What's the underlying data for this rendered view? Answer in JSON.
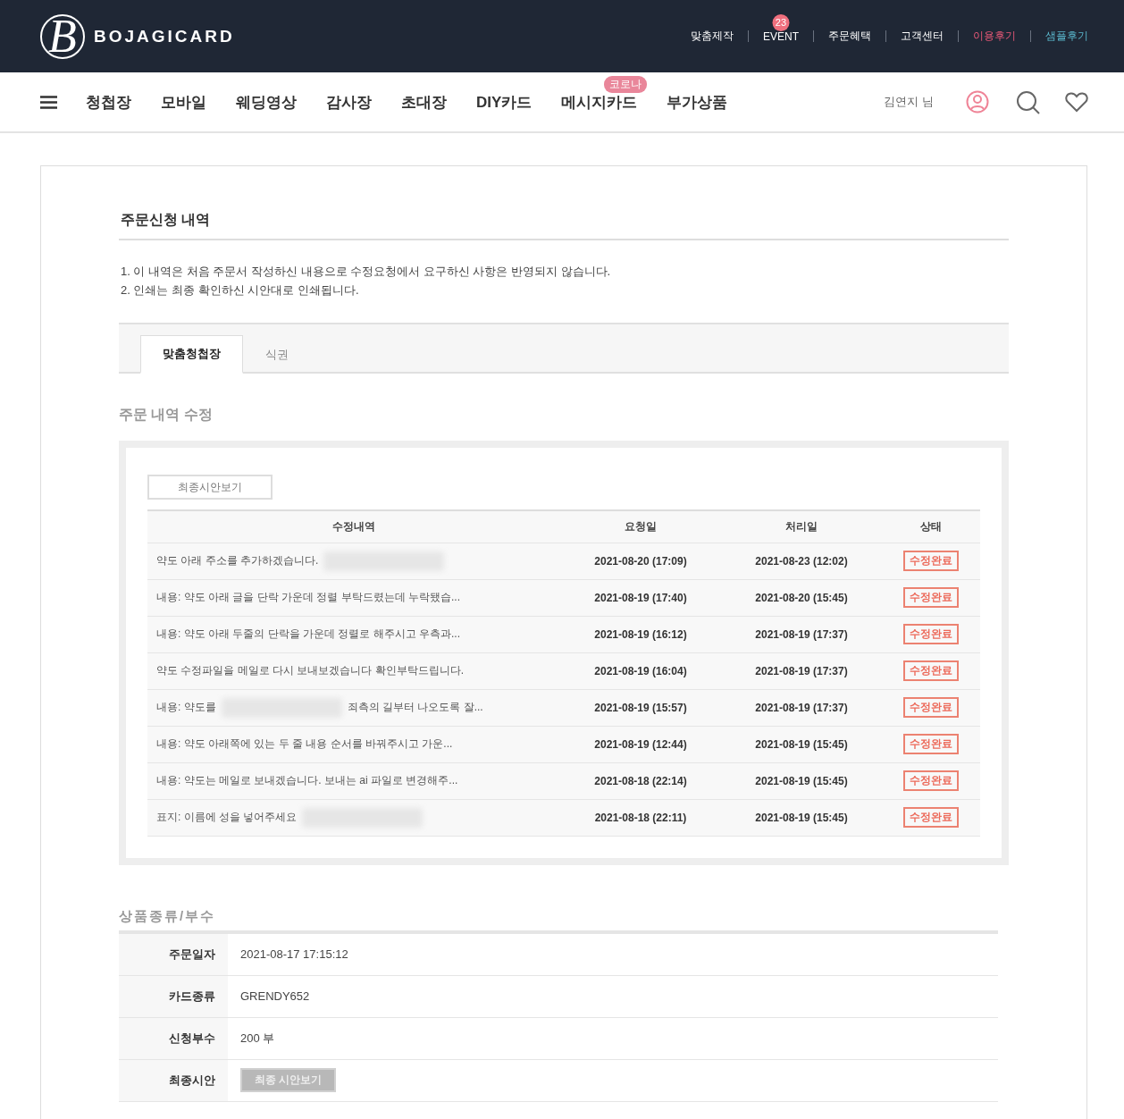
{
  "header": {
    "logo_mark": "B",
    "logo_text": "BOJAGICARD",
    "top_links": [
      {
        "label": "맞춤제작",
        "kind": "plain"
      },
      {
        "label": "EVENT",
        "kind": "plain",
        "badge": "23"
      },
      {
        "label": "주문혜택",
        "kind": "plain"
      },
      {
        "label": "고객센터",
        "kind": "plain"
      },
      {
        "label": "이용후기",
        "kind": "review"
      },
      {
        "label": "샘플후기",
        "kind": "sample"
      }
    ]
  },
  "nav": {
    "items": [
      {
        "label": "청첩장"
      },
      {
        "label": "모바일"
      },
      {
        "label": "웨딩영상"
      },
      {
        "label": "감사장"
      },
      {
        "label": "초대장"
      },
      {
        "label": "DIY카드"
      },
      {
        "label": "메시지카드",
        "badge": "코로나"
      },
      {
        "label": "부가상품"
      }
    ],
    "user": "김연지 님"
  },
  "page": {
    "title": "주문신청 내역",
    "notes": [
      "1. 이 내역은 처음 주문서 작성하신 내용으로 수정요청에서 요구하신 사항은 반영되지 않습니다.",
      "2. 인쇄는 최종 확인하신 시안대로 인쇄됩니다."
    ],
    "tabs": [
      {
        "label": "맞춤청첩장",
        "selected": true
      },
      {
        "label": "식권",
        "selected": false
      }
    ]
  },
  "revisions": {
    "title": "주문 내역 수정",
    "preview_button": "최종시안보기",
    "columns": [
      "수정내역",
      "요청일",
      "처리일",
      "상태"
    ],
    "rows": [
      {
        "segments": [
          {
            "kind": "text",
            "text": "약도 아래 주소를 추가하겠습니다."
          },
          {
            "kind": "redacted"
          }
        ],
        "requested": "2021-08-20 (17:09)",
        "processed": "2021-08-23 (12:02)",
        "status": "수정완료"
      },
      {
        "segments": [
          {
            "kind": "text",
            "text": "내용: 약도 아래 글을 단락 가운데 정렬 부탁드렸는데 누락됐습..."
          }
        ],
        "requested": "2021-08-19 (17:40)",
        "processed": "2021-08-20 (15:45)",
        "status": "수정완료"
      },
      {
        "segments": [
          {
            "kind": "text",
            "text": "내용: 약도 아래 두줄의 단락을 가운데 정렬로 해주시고 우측과..."
          }
        ],
        "requested": "2021-08-19 (16:12)",
        "processed": "2021-08-19 (17:37)",
        "status": "수정완료"
      },
      {
        "segments": [
          {
            "kind": "text",
            "text": "약도 수정파일을 메일로 다시 보내보겠습니다 확인부탁드립니다."
          }
        ],
        "requested": "2021-08-19 (16:04)",
        "processed": "2021-08-19 (17:37)",
        "status": "수정완료"
      },
      {
        "segments": [
          {
            "kind": "text",
            "text": "내용: 약도를"
          },
          {
            "kind": "redacted"
          },
          {
            "kind": "text",
            "text": "죄측의 길부터 나오도록 잘..."
          }
        ],
        "requested": "2021-08-19 (15:57)",
        "processed": "2021-08-19 (17:37)",
        "status": "수정완료"
      },
      {
        "segments": [
          {
            "kind": "text",
            "text": "내용: 약도 아래쪽에 있는 두 줄 내용 순서를 바꿔주시고 가운..."
          }
        ],
        "requested": "2021-08-19 (12:44)",
        "processed": "2021-08-19 (15:45)",
        "status": "수정완료"
      },
      {
        "segments": [
          {
            "kind": "text",
            "text": "내용: 약도는 메일로 보내겠습니다. 보내는 ai 파일로 변경해주..."
          }
        ],
        "requested": "2021-08-18 (22:14)",
        "processed": "2021-08-19 (15:45)",
        "status": "수정완료"
      },
      {
        "segments": [
          {
            "kind": "text",
            "text": "표지: 이름에 성을 넣어주세요"
          },
          {
            "kind": "redacted"
          }
        ],
        "requested": "2021-08-18 (22:11)",
        "processed": "2021-08-19 (15:45)",
        "status": "수정완료"
      }
    ]
  },
  "product": {
    "title": "상품종류/부수",
    "rows": [
      {
        "kind": "text",
        "label": "주문일자",
        "value": "2021-08-17 17:15:12"
      },
      {
        "kind": "text",
        "label": "카드종류",
        "value": "GRENDY652"
      },
      {
        "kind": "text",
        "label": "신청부수",
        "value": "200 부"
      },
      {
        "kind": "button",
        "label": "최종시안",
        "value": "최종 시안보기"
      }
    ]
  }
}
